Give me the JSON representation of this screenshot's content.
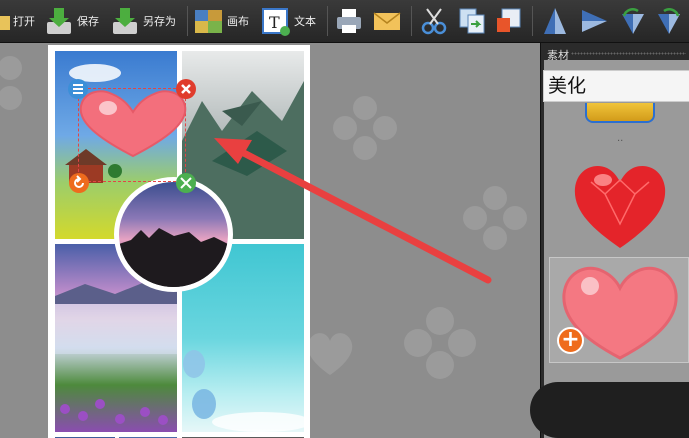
{
  "toolbar": {
    "open_label": "打开",
    "save_label": "保存",
    "save_as_label": "另存为",
    "canvas_label": "画布",
    "text_label": "文本",
    "text_icon_letter": "T"
  },
  "panel": {
    "title": "素材",
    "category": "美化",
    "small_dots": ".."
  },
  "add_button": {
    "label": "+"
  },
  "colors": {
    "toolbar_bg": "#2e2e2e",
    "workspace_bg": "#8d8d8d",
    "heart_pink": "#f36f7c",
    "heart_red": "#e4242a",
    "arrow_red": "#e94040",
    "accent_orange": "#ef6c1c"
  }
}
